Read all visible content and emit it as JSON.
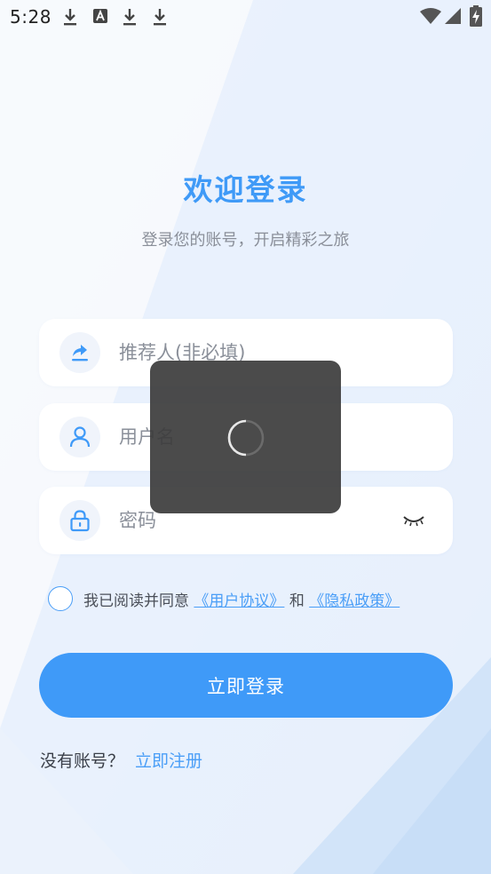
{
  "status_bar": {
    "time": "5:28",
    "notification_icons": [
      "download-icon",
      "app-notification-icon",
      "download-icon",
      "download-icon"
    ],
    "system_icons": [
      "wifi-icon",
      "cellular-signal-icon",
      "battery-charging-icon"
    ]
  },
  "login": {
    "title": "欢迎登录",
    "subtitle": "登录您的账号，开启精彩之旅",
    "referrer": {
      "placeholder": "推荐人(非必填)",
      "value": "",
      "icon": "share-arrow-icon"
    },
    "username": {
      "placeholder": "用户名",
      "value": "",
      "icon": "user-icon"
    },
    "password": {
      "placeholder": "密码",
      "value": "",
      "icon": "lock-icon",
      "toggle_icon": "eye-closed-icon"
    },
    "agreement": {
      "checked": false,
      "prefix": "我已阅读并同意",
      "user_agreement": "《用户协议》",
      "conjunction": "和",
      "privacy_policy": "《隐私政策》"
    },
    "submit_label": "立即登录",
    "register_prompt": "没有账号？",
    "register_link": "立即注册"
  },
  "loading": {
    "visible": true,
    "icon": "spinner-icon"
  },
  "colors": {
    "accent": "#3f9af8",
    "title": "#3f9af7",
    "overlay": "#3c3c3c",
    "background": "#f2f7fd"
  }
}
